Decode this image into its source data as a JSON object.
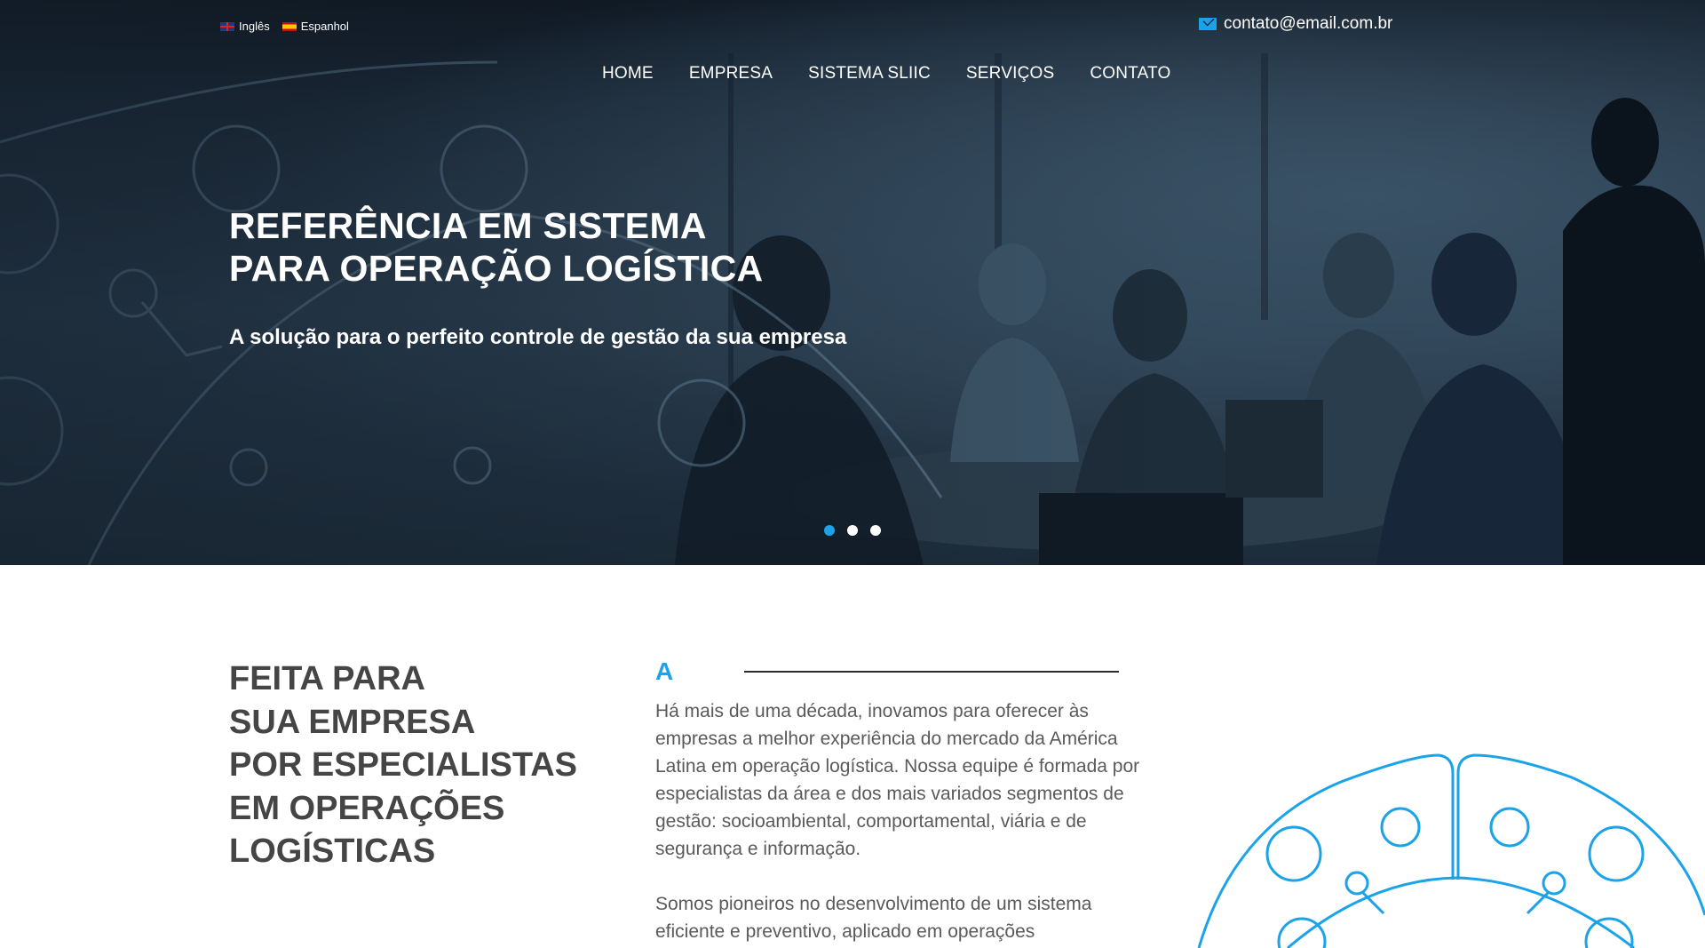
{
  "header": {
    "languages": [
      {
        "label": "Inglês",
        "flag": "uk-flag-icon"
      },
      {
        "label": "Espanhol",
        "flag": "spain-flag-icon"
      }
    ],
    "email": "contato@email.com.br",
    "email_icon": "envelope-icon"
  },
  "nav": {
    "items": [
      "HOME",
      "EMPRESA",
      "SISTEMA SLIIC",
      "SERVIÇOS",
      "CONTATO"
    ]
  },
  "hero": {
    "title_line1": "REFERÊNCIA EM SISTEMA",
    "title_line2": "PARA OPERAÇÃO LOGÍSTICA",
    "subtitle": "A solução para o perfeito controle de gestão da sua empresa",
    "slides_total": 3,
    "active_slide": 1
  },
  "about": {
    "heading_lines": [
      "FEITA PARA",
      "SUA EMPRESA",
      "POR ESPECIALISTAS",
      "EM OPERAÇÕES",
      "LOGÍSTICAS"
    ],
    "letter": "A",
    "paragraph1": "Há mais de uma década, inovamos para oferecer às empresas a melhor experiência do mercado da América Latina em operação logística. Nossa equipe é formada por especialistas da área e dos mais variados segmentos de gestão: socioambiental, comportamental, viária e de segurança e informação.",
    "paragraph2": "Somos pioneiros no desenvolvimento de um sistema eficiente e preventivo, aplicado em operações"
  },
  "colors": {
    "accent": "#1aa3e8",
    "heading": "#454545",
    "body_text": "#5a5a5a",
    "hero_dark": "#1a2735"
  }
}
